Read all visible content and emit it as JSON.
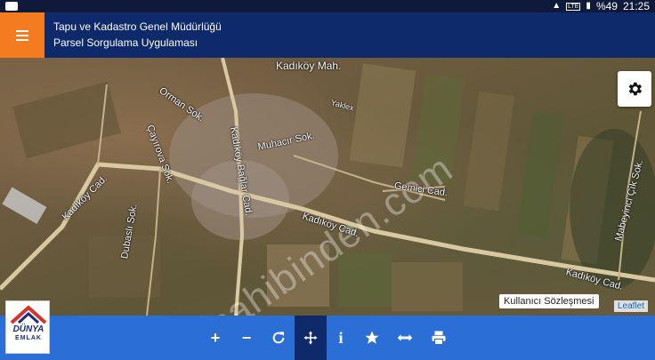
{
  "status_bar": {
    "network": "LTE",
    "battery": "%49",
    "time": "21:25"
  },
  "header": {
    "title_line1": "Tapu ve Kadastro Genel Müdürlüğü",
    "title_line2": "Parsel Sorgulama Uygulaması"
  },
  "map": {
    "labels": {
      "kadikoy_mah": "Kadıköy Mah.",
      "orman_sok": "Orman Sok.",
      "cayirova_sok": "Çayırova Sok.",
      "muhacir_sok": "Muhacır Sok.",
      "kadikoy_baglar_cad": "Kadıköy Bağlar Cad.",
      "kadikoy_cad_west": "Kadıköy Cad.",
      "kadikoy_cad_center": "Kadıköy Cad.",
      "kadikoy_cad_east": "Kadıköy Cad.",
      "gemici_cad": "Gemici Cad.",
      "mabeyinci_cik_sok": "Mabeyinci Çık Sok.",
      "dubasli_sok": "Dubaslı Sok.",
      "yaklex": "Yaklex"
    },
    "watermark": "sahibinden.com",
    "terms_button": "Kullanıcı Sözleşmesi",
    "attribution": "Leaflet"
  },
  "toolbar": {
    "tools": [
      "zoom-in",
      "zoom-out",
      "refresh",
      "pan",
      "info",
      "favorite",
      "measure",
      "print"
    ],
    "active_tool": "pan",
    "zoom_in": "+",
    "zoom_out": "−",
    "info": "i"
  },
  "logo": {
    "line1": "DÜNYA",
    "line2": "EMLAK"
  },
  "colors": {
    "header_bg": "#0e2a6b",
    "menu_accent": "#f47b20",
    "toolbar_bg": "#2b6fd6"
  }
}
